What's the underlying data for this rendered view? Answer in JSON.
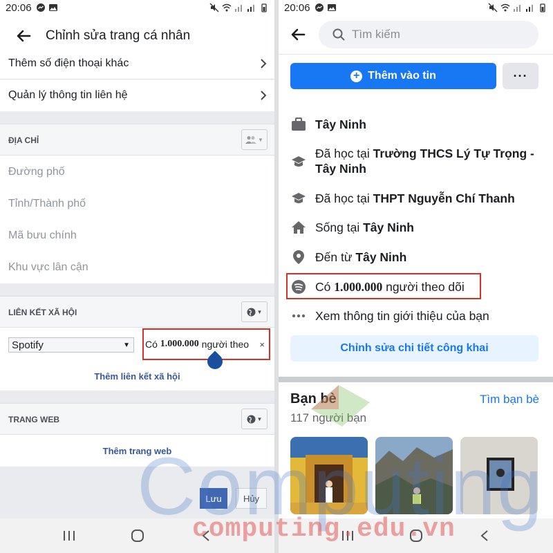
{
  "status": {
    "time_left": "20:06",
    "time_right": "20:06"
  },
  "left": {
    "title": "Chỉnh sửa trang cá nhân",
    "rows": {
      "more_phone": "Thêm số điện thoại khác",
      "manage_contact": "Quản lý thông tin liên hệ"
    },
    "address": {
      "label": "ĐỊA CHỈ",
      "fields": [
        "Đường phố",
        "Tỉnh/Thành phố",
        "Mã bưu chính",
        "Khu vực lân cận"
      ]
    },
    "social": {
      "label": "LIÊN KẾT XÃ HỘI",
      "select_value": "Spotify",
      "text_value_prefix": "Có ",
      "text_value_bold": "1.000.000",
      "text_value_suffix": " người theo",
      "clear": "×",
      "add_link": "Thêm liên kết xã hội"
    },
    "website": {
      "label": "TRANG WEB",
      "add_link": "Thêm trang web"
    },
    "save": "Lưu",
    "cancel": "Hủy"
  },
  "right": {
    "search_placeholder": "Tìm kiếm",
    "add_story": "Thêm vào tin",
    "more": "···",
    "info": [
      {
        "icon": "briefcase-icon",
        "prefix": "",
        "bold": "Tây Ninh",
        "suffix": ""
      },
      {
        "icon": "graduation-cap-icon",
        "prefix": "Đã học tại ",
        "bold": "Trường THCS Lý Tự Trọng - Tây Ninh",
        "suffix": ""
      },
      {
        "icon": "graduation-cap-icon",
        "prefix": "Đã học tại ",
        "bold": "THPT Nguyễn Chí Thanh",
        "suffix": ""
      },
      {
        "icon": "home-icon",
        "prefix": "Sống tại ",
        "bold": "Tây Ninh",
        "suffix": ""
      },
      {
        "icon": "location-pin-icon",
        "prefix": "Đến từ ",
        "bold": "Tây Ninh",
        "suffix": ""
      },
      {
        "icon": "spotify-icon",
        "prefix": "Có ",
        "bold": "1.000.000",
        "suffix": " người theo dõi"
      },
      {
        "icon": "ellipsis-icon",
        "prefix": "Xem thông tin giới thiệu của bạn",
        "bold": "",
        "suffix": ""
      }
    ],
    "edit_public": "Chỉnh sửa chi tiết công khai",
    "friends": {
      "title": "Bạn bè",
      "count": "117 người bạn",
      "find": "Tìm bạn bè"
    }
  },
  "watermark": {
    "line1": "Computing",
    "line2": "computing.edu.vn"
  },
  "colors": {
    "fb_blue": "#1877f2",
    "highlight_red": "#d93025",
    "link_blue": "#365899"
  }
}
